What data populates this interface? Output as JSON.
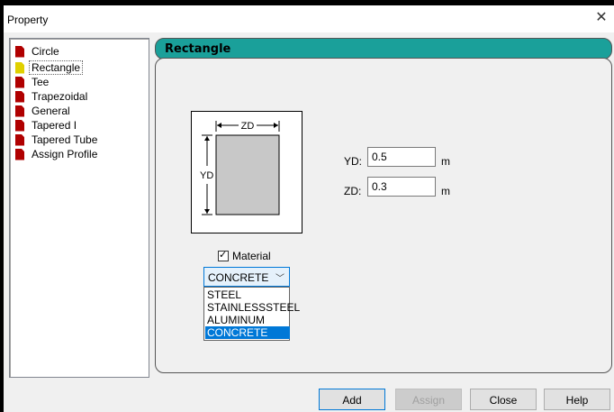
{
  "window": {
    "title": "Property"
  },
  "tree": {
    "items": [
      {
        "label": "Circle"
      },
      {
        "label": "Rectangle"
      },
      {
        "label": "Tee"
      },
      {
        "label": "Trapezoidal"
      },
      {
        "label": "General"
      },
      {
        "label": "Tapered I"
      },
      {
        "label": "Tapered Tube"
      },
      {
        "label": "Assign Profile"
      }
    ],
    "selected": "Rectangle"
  },
  "section": {
    "title": "Rectangle",
    "diagram": {
      "width_label": "ZD",
      "height_label": "YD"
    },
    "fields": [
      {
        "label": "YD:",
        "value": "0.5",
        "unit": "m"
      },
      {
        "label": "ZD:",
        "value": "0.3",
        "unit": "m"
      }
    ],
    "material": {
      "label": "Material",
      "checked": true,
      "selected": "CONCRETE",
      "options": [
        "STEEL",
        "STAINLESSSTEEL",
        "ALUMINUM",
        "CONCRETE"
      ]
    }
  },
  "buttons": {
    "add": "Add",
    "assign": "Assign",
    "close": "Close",
    "help": "Help"
  },
  "icons": {
    "close": "close-icon",
    "checkbox": "check-icon",
    "dropdown": "chevron-down-icon",
    "tree": "document-icon"
  },
  "colors": {
    "header": "#1aa09a",
    "selection": "#0078d7"
  }
}
